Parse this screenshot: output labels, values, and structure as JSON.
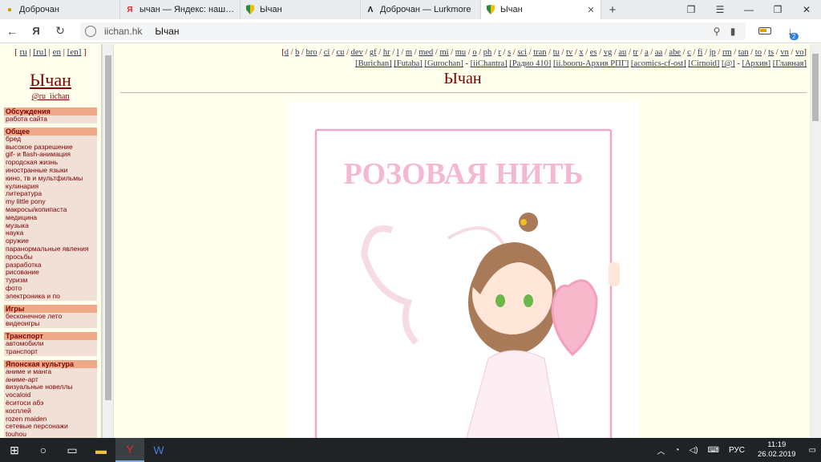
{
  "browser": {
    "tabs": [
      {
        "title": "Доброчан",
        "favicon": "dobrochan-favicon",
        "active": false
      },
      {
        "title": "ычан — Яндекс: нашлось",
        "favicon": "yandex-favicon",
        "active": false
      },
      {
        "title": "Ычан",
        "favicon": "iichan-favicon",
        "active": false
      },
      {
        "title": "Доброчан — Lurkmore",
        "favicon": "lurkmore-favicon",
        "active": false
      },
      {
        "title": "Ычан",
        "favicon": "iichan-favicon",
        "active": true
      }
    ],
    "address": {
      "host": "iichan.hk",
      "page_title": "Ычан"
    },
    "download_badge": "2"
  },
  "sidebar": {
    "langs": [
      "ru",
      "[ru]",
      "en",
      "[en]"
    ],
    "logo": "Ычан",
    "handle": "@ru_iichan",
    "sections": [
      {
        "title": "Обсуждения",
        "items": [
          "работа сайта"
        ]
      },
      {
        "title": "Общее",
        "items": [
          "бред",
          "высокое разрешение",
          "gif- и flash-анимация",
          "городская жизнь",
          "иностранные языки",
          "кино, тв и мультфильмы",
          "кулинария",
          "литература",
          "my little pony",
          "макросы/копипаста",
          "медицина",
          "музыка",
          "наука",
          "оружие",
          "паранормальные явления",
          "просьбы",
          "разработка",
          "рисование",
          "туризм",
          "фото",
          "электроника и по"
        ]
      },
      {
        "title": "Игры",
        "items": [
          "бесконечное лето",
          "видеоигры"
        ]
      },
      {
        "title": "Транспорт",
        "items": [
          "автомобили",
          "транспорт"
        ]
      },
      {
        "title": "Японская культура",
        "items": [
          "аниме и манга",
          "аниме-арт",
          "визуальные новеллы",
          "vocaloid",
          "ёситоси абэ",
          "косплей",
          "rozen maiden",
          "сетевые персонажи",
          "touhou"
        ]
      }
    ]
  },
  "boards_row1": [
    "d",
    "b",
    "bro",
    "ci",
    "cu",
    "dev",
    "gf",
    "hr",
    "l",
    "m",
    "med",
    "mi",
    "mu",
    "o",
    "ph",
    "r",
    "s",
    "sci",
    "tran",
    "tu",
    "tv",
    "x",
    "es",
    "vg",
    "au",
    "tr",
    "a",
    "aa",
    "abe",
    "c",
    "fi",
    "jp",
    "rm",
    "tan",
    "to",
    "ts",
    "vn",
    "vo"
  ],
  "boards_row2": [
    "[Burichan]",
    "[Futaba]",
    "[Gurochan]",
    "-",
    "[iiChantra]",
    "[Радио 410]",
    "[ii.booru-Архив РПГ]",
    "[acomics-cf-ost]",
    "[Cirnoid]",
    "[@]",
    "-",
    "[Архив]",
    "[Главная]"
  ],
  "board_title": "Ычан",
  "banner": {
    "title": "РОЗОВАЯ НИТЬ"
  },
  "taskbar": {
    "lang": "РУС",
    "time": "11:19",
    "date": "26.02.2019"
  }
}
